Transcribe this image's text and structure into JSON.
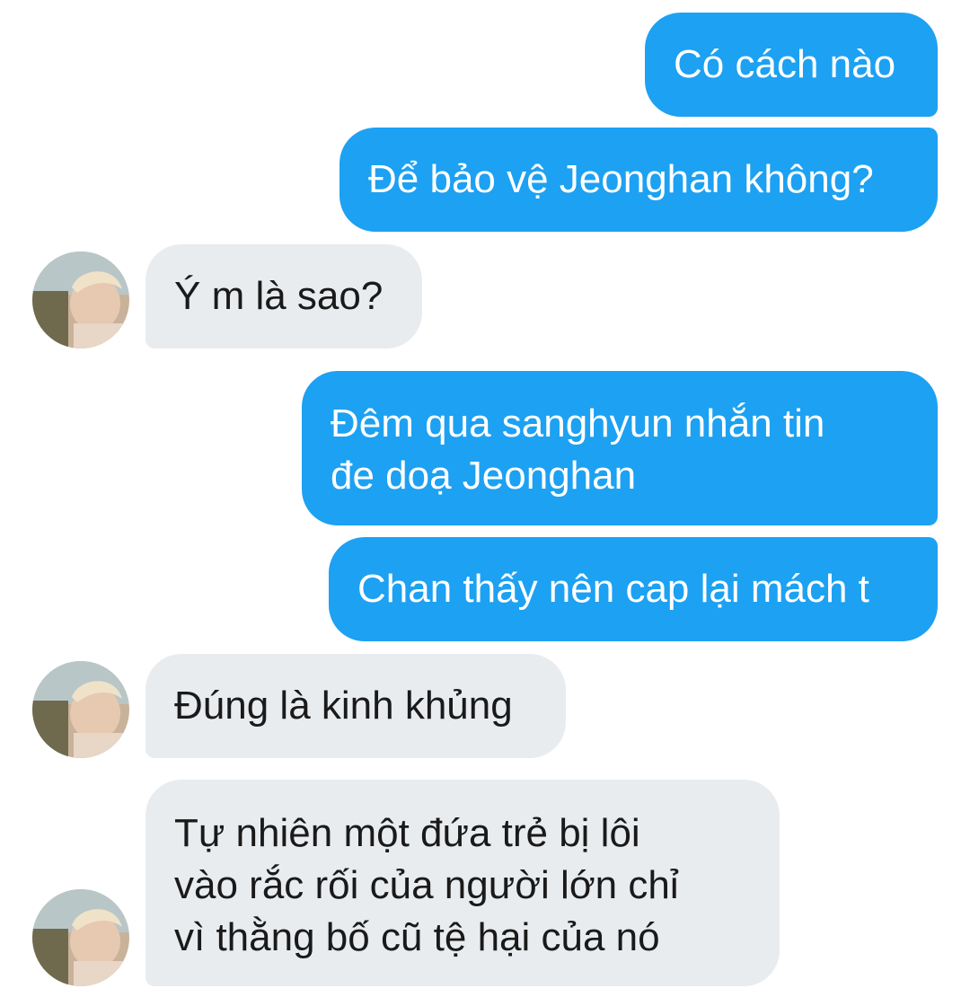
{
  "conversation": {
    "messages": [
      {
        "sender": "me",
        "text": "Có cách nào"
      },
      {
        "sender": "me",
        "text": "Để bảo vệ Jeonghan không?"
      },
      {
        "sender": "contact",
        "text": "Ý m là sao?"
      },
      {
        "sender": "me",
        "text": "Đêm qua sanghyun nhắn tin\nđe doạ Jeonghan"
      },
      {
        "sender": "me",
        "text": "Chan thấy nên cap lại mách t"
      },
      {
        "sender": "contact",
        "text": "Đúng là kinh khủng"
      },
      {
        "sender": "contact",
        "text": "Tự nhiên một đứa trẻ bị lôi\nvào rắc rối của người lớn chỉ\nvì thằng bố cũ tệ hại của nó"
      }
    ]
  },
  "colors": {
    "sent_bubble": "#1da1f2",
    "received_bubble": "#e9ecef",
    "background": "#ffffff"
  },
  "icons": {
    "avatar": "contact-avatar-photo"
  }
}
